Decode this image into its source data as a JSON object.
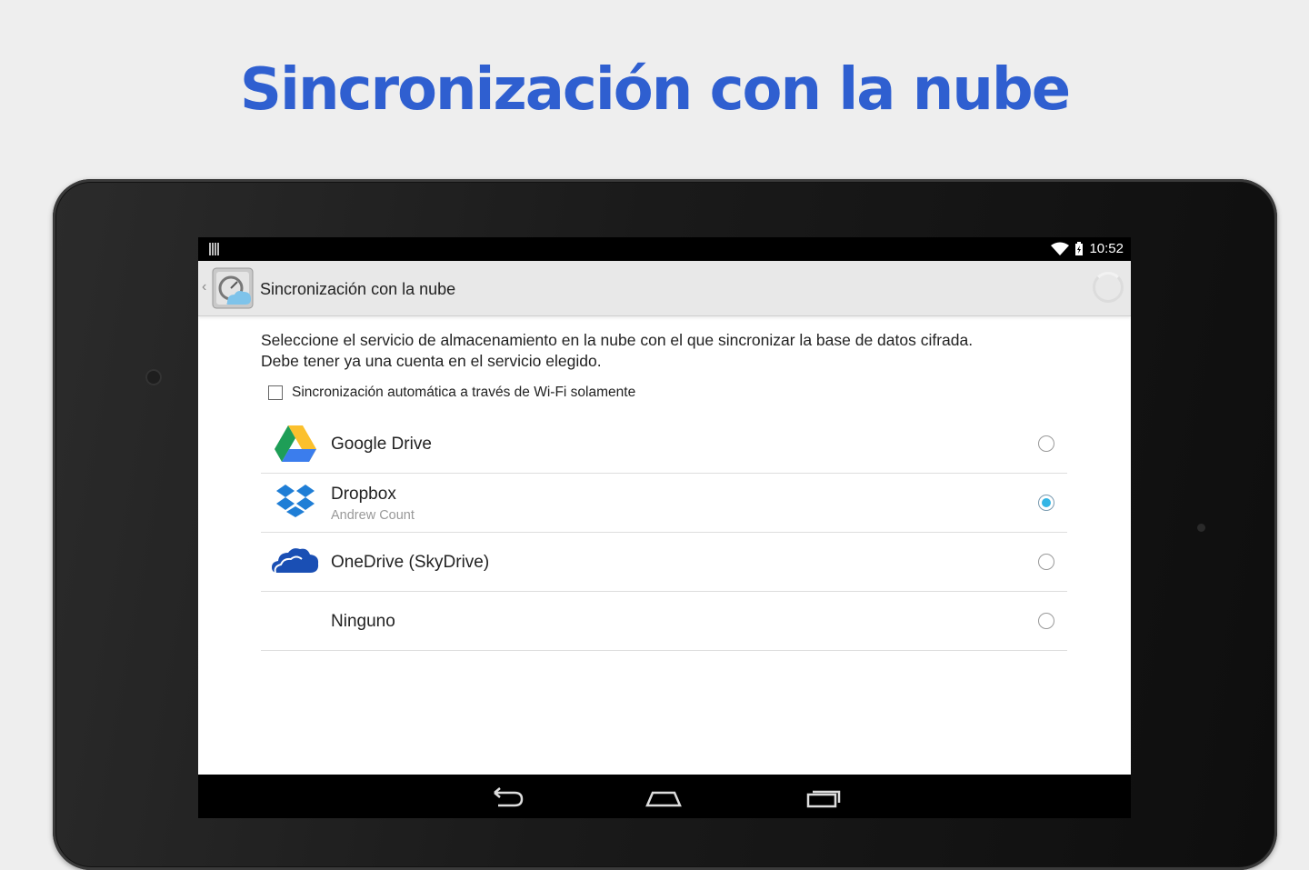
{
  "headline": "Sincronización con la nube",
  "status_bar": {
    "time": "10:52",
    "icons": [
      "barcode-icon",
      "wifi-icon",
      "battery-icon"
    ]
  },
  "action_bar": {
    "title": "Sincronización con la nube",
    "app_icon": "cloud-sync-app-icon"
  },
  "content": {
    "description_line1": "Seleccione el servicio de almacenamiento en la nube con el que sincronizar la base de datos cifrada.",
    "description_line2": "Debe tener ya una cuenta en el servicio elegido.",
    "wifi_only_label": "Sincronización automática a través de Wi-Fi solamente",
    "wifi_only_checked": false,
    "services": [
      {
        "title": "Google Drive",
        "subtitle": "",
        "icon": "google-drive-icon",
        "selected": false
      },
      {
        "title": "Dropbox",
        "subtitle": "Andrew Count",
        "icon": "dropbox-icon",
        "selected": true
      },
      {
        "title": "OneDrive (SkyDrive)",
        "subtitle": "",
        "icon": "onedrive-icon",
        "selected": false
      },
      {
        "title": "Ninguno",
        "subtitle": "",
        "icon": "",
        "selected": false
      }
    ]
  },
  "nav_bar": {
    "buttons": [
      "back-icon",
      "home-icon",
      "recents-icon"
    ]
  },
  "colors": {
    "headline": "#2f5fd0",
    "radio_selected": "#33b5e5",
    "device": "#121212"
  }
}
